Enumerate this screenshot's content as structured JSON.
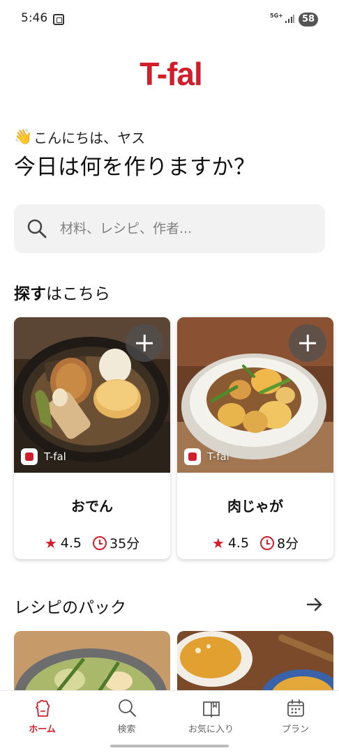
{
  "status_bar": {
    "time": "5:46",
    "network": "5G+",
    "battery": "58"
  },
  "brand": {
    "logo_text": "T-fal",
    "accent": "#d21e2b"
  },
  "greeting": {
    "hello": "こんにちは、ヤス",
    "question": "今日は何を作りますか？"
  },
  "search": {
    "placeholder": "材料、レシピ、作者..."
  },
  "explore": {
    "title_bold": "探す",
    "title_rest": "はこちら"
  },
  "recipes": [
    {
      "title": "おでん",
      "brand": "T-fal",
      "rating": "4.5",
      "time": "35分",
      "image_icon": "oden-dish-image"
    },
    {
      "title": "肉じゃが",
      "brand": "T-fal",
      "rating": "4.5",
      "time": "8分",
      "image_icon": "nikujaga-dish-image"
    }
  ],
  "packs": {
    "title": "レシピのパック"
  },
  "nav": [
    {
      "label": "ホーム",
      "icon": "home-icon",
      "active": true
    },
    {
      "label": "検索",
      "icon": "search-icon"
    },
    {
      "label": "お気に入り",
      "icon": "book-icon"
    },
    {
      "label": "プラン",
      "icon": "calendar-icon"
    }
  ]
}
